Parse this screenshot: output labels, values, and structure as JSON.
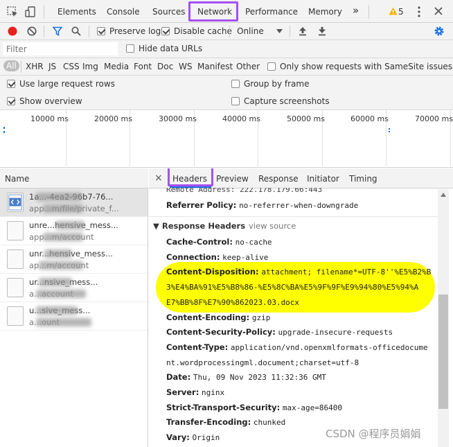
{
  "devtools_tabs": [
    "Elements",
    "Console",
    "Sources",
    "Network",
    "Performance",
    "Memory"
  ],
  "more_tabs": "»",
  "warnings": {
    "count": "5"
  },
  "toolbar": {
    "preserve_log": "Preserve log",
    "disable_cache": "Disable cache",
    "throttle": "Online"
  },
  "filter": {
    "placeholder": "Filter",
    "hide_data_urls": "Hide data URLs",
    "types": [
      "All",
      "XHR",
      "JS",
      "CSS",
      "Img",
      "Media",
      "Font",
      "Doc",
      "WS",
      "Manifest",
      "Other"
    ],
    "samesite": "Only show requests with SameSite issues"
  },
  "options": {
    "large_rows": "Use large request rows",
    "group_by_frame": "Group by frame",
    "show_overview": "Show overview",
    "capture_screenshots": "Capture screenshots"
  },
  "timeline_ticks": [
    "10000 ms",
    "20000 ms",
    "30000 ms",
    "40000 ms",
    "50000 ms",
    "60000 ms",
    "70000 ms"
  ],
  "request_list": {
    "header": "Name",
    "rows": [
      {
        "name": "1a...-4ea2-96b7-76...",
        "sub": "app...m/file/private_f..."
      },
      {
        "name": "unre...hensive_mess...",
        "sub": "app...m/account"
      },
      {
        "name": "unr...hensive_mess...",
        "sub": "ap...m/account"
      },
      {
        "name": "ur...nsive_mess...",
        "sub": "a...account"
      },
      {
        "name": "u...sive_mess...",
        "sub": "a...ount"
      }
    ]
  },
  "detail_tabs": [
    "Headers",
    "Preview",
    "Response",
    "Initiator",
    "Timing"
  ],
  "close_glyph": "×",
  "headers": {
    "remote_address_partial": "Remote Address: 222.178.179.66:443",
    "referrer_policy": {
      "key": "Referrer Policy:",
      "value": "no-referrer-when-downgrade"
    },
    "response_section": "▼ Response Headers",
    "view_source": "view source",
    "list": [
      {
        "key": "Cache-Control:",
        "value": "no-cache"
      },
      {
        "key": "Connection:",
        "value": "keep-alive"
      },
      {
        "key": "Content-Disposition:",
        "value": "attachment; filename*=UTF-8''%E5%B2%B"
      },
      {
        "key": "",
        "value": "3%E4%BA%91%E5%B8%86-%E5%8C%BA%E5%9F%9F%E9%94%80%E5%94%A"
      },
      {
        "key": "",
        "value": "E7%BB%8F%E7%90%862023.03.docx"
      },
      {
        "key": "Content-Encoding:",
        "value": "gzip"
      },
      {
        "key": "Content-Security-Policy:",
        "value": "upgrade-insecure-requests"
      },
      {
        "key": "Content-Type:",
        "value": "application/vnd.openxmlformats-officedocume"
      },
      {
        "key": "",
        "value": "nt.wordprocessingml.document;charset=utf-8"
      },
      {
        "key": "Date:",
        "value": "Thu, 09 Nov 2023 11:32:36 GMT"
      },
      {
        "key": "Server:",
        "value": "nginx"
      },
      {
        "key": "Strict-Transport-Security:",
        "value": "max-age=86400"
      },
      {
        "key": "Transfer-Encoding:",
        "value": "chunked"
      },
      {
        "key": "Vary:",
        "value": "Origin"
      }
    ]
  },
  "watermark": "CSDN @程序员娟娟",
  "colors": {
    "highlight": "#ffff00",
    "annotation_box": "#a64ff0",
    "record_red": "#e8201c",
    "accent_blue": "#1a73e8"
  }
}
